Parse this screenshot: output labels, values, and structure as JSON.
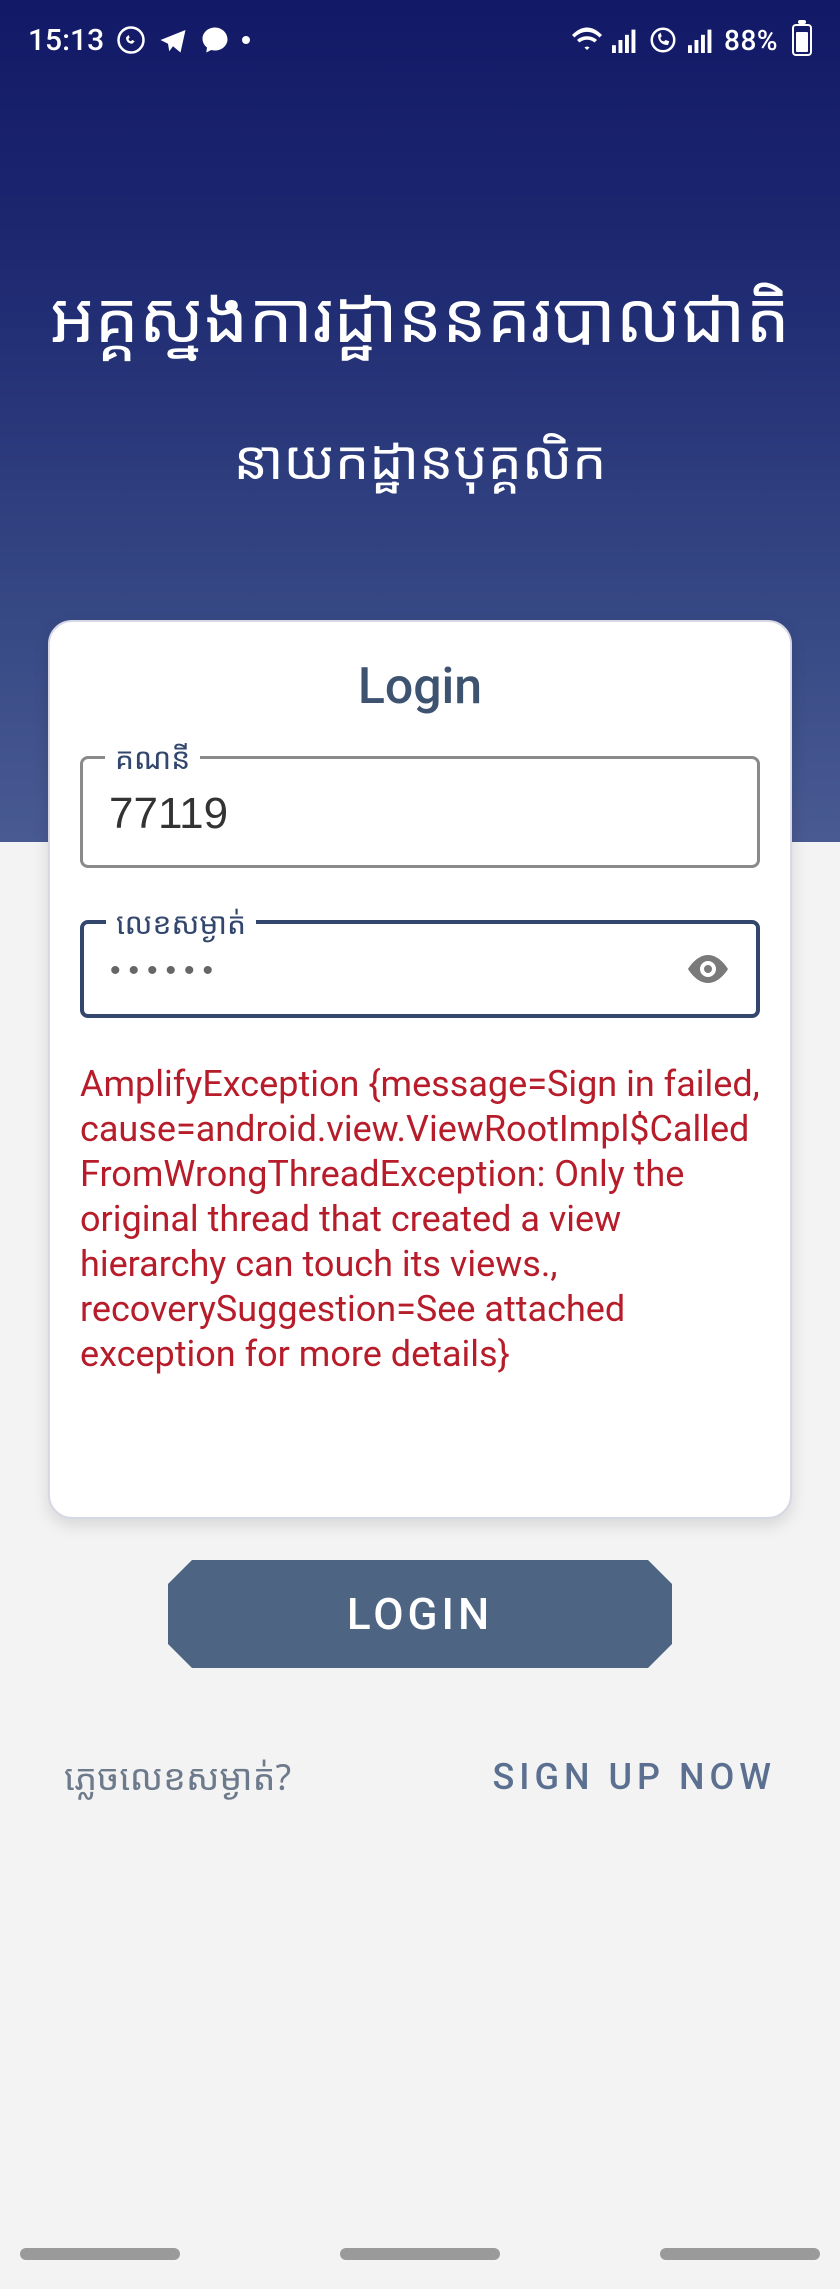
{
  "status": {
    "time": "15:13",
    "battery": "88%"
  },
  "header": {
    "title": "អគ្គស្នងការដ្ឋាននគរបាលជាតិ",
    "subtitle": "នាយកដ្ឋានបុគ្គលិក"
  },
  "card": {
    "title": "Login",
    "account": {
      "label": "គណនី",
      "value": "77119"
    },
    "password": {
      "label": "លេខសម្ងាត់",
      "value": "••••••"
    },
    "error": "AmplifyException {message=Sign in failed, cause=android.view.ViewRootImpl$CalledFromWrongThreadException: Only the original thread that created a view hierarchy can touch its views., recoverySuggestion=See attached exception for more details}"
  },
  "actions": {
    "login": "LOGIN",
    "forgot": "ភ្លេចលេខសម្ងាត់?",
    "signup": "SIGN UP NOW"
  }
}
